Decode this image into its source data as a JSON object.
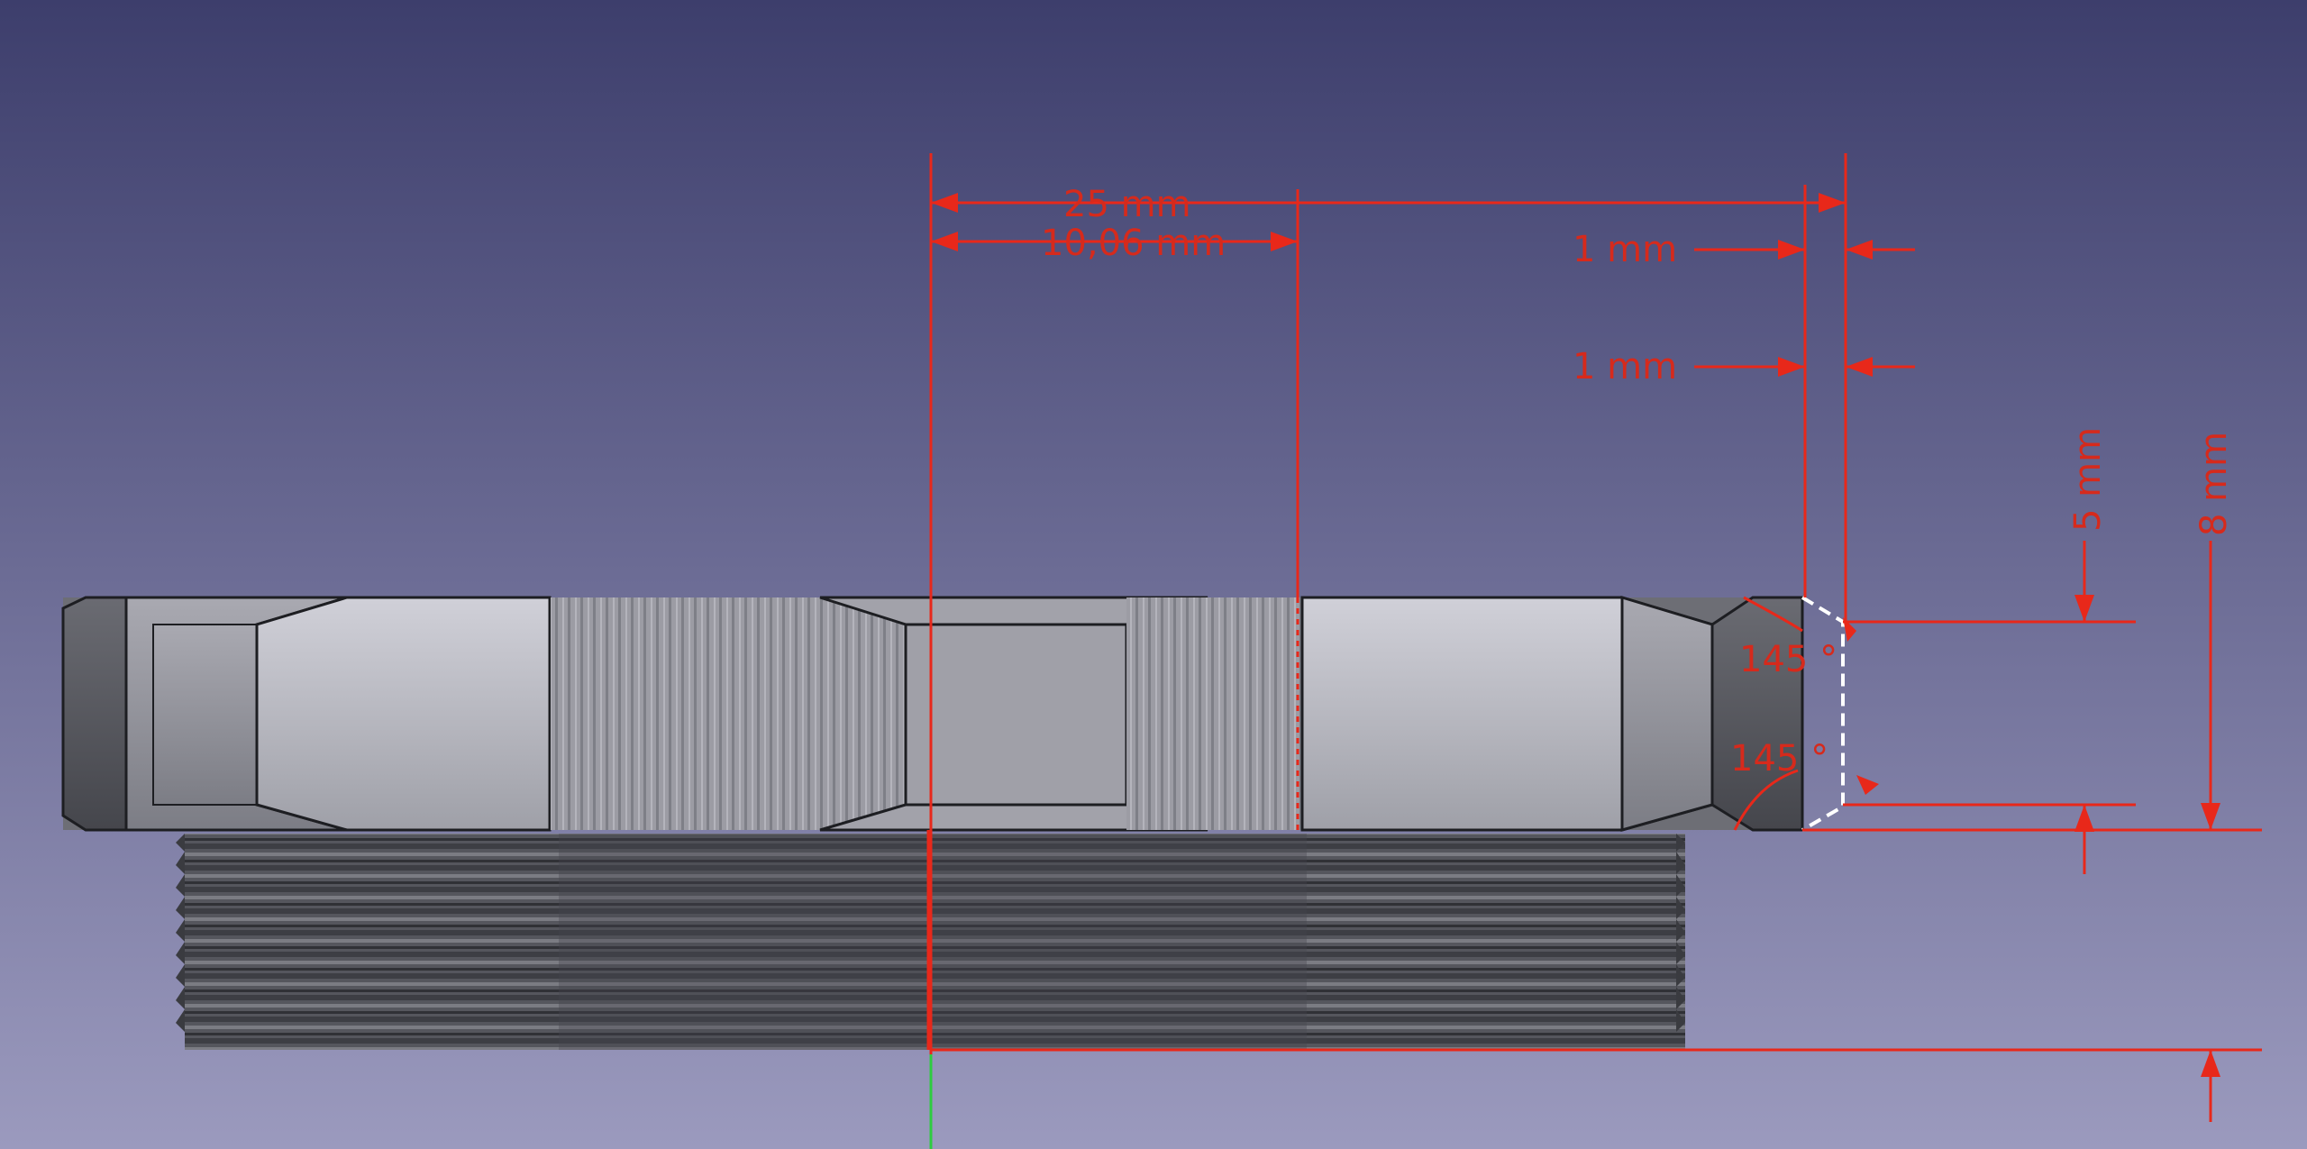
{
  "viewport": {
    "background_top": "#3e3f6e",
    "background_bottom": "#9a99bd",
    "dimension_color": "#e8281a",
    "part_color": "#8a8b92"
  },
  "dimensions": {
    "overall_width": "25 mm",
    "bore_radius": "10,06 mm",
    "chamfer_top": "1 mm",
    "chamfer_bottom": "1 mm",
    "nut_height": "5 mm",
    "total_height": "8 mm",
    "angle_top": "145 °",
    "angle_bottom": "145 °"
  }
}
